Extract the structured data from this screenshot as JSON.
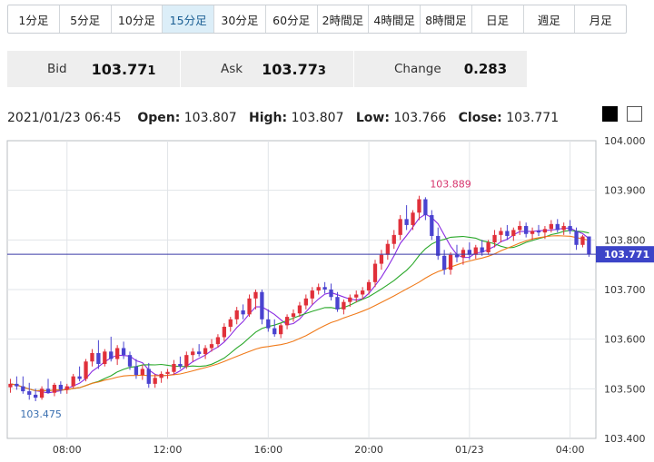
{
  "timeframes": [
    {
      "label": "1分足",
      "active": false
    },
    {
      "label": "5分足",
      "active": false
    },
    {
      "label": "10分足",
      "active": false
    },
    {
      "label": "15分足",
      "active": true
    },
    {
      "label": "30分足",
      "active": false
    },
    {
      "label": "60分足",
      "active": false
    },
    {
      "label": "2時間足",
      "active": false
    },
    {
      "label": "4時間足",
      "active": false
    },
    {
      "label": "8時間足",
      "active": false
    },
    {
      "label": "日足",
      "active": false
    },
    {
      "label": "週足",
      "active": false
    },
    {
      "label": "月足",
      "active": false
    }
  ],
  "quote": {
    "bid_label": "Bid",
    "bid_main": "103.77",
    "bid_last": "1",
    "ask_label": "Ask",
    "ask_main": "103.77",
    "ask_last": "3",
    "change_label": "Change",
    "change_value": "0.283"
  },
  "ohlc": {
    "datetime": "2021/01/23 06:45",
    "open_label": "Open:",
    "open": "103.807",
    "high_label": "High:",
    "high": "103.807",
    "low_label": "Low:",
    "low": "103.766",
    "close_label": "Close:",
    "close": "103.771"
  },
  "theme_swatches": [
    "black",
    "white"
  ],
  "chart_data": {
    "type": "candlestick",
    "instrument_precision": 3,
    "ylim": [
      103.4,
      104.0
    ],
    "y_ticks": [
      "104.000",
      "103.900",
      "103.800",
      "103.700",
      "103.600",
      "103.500",
      "103.400"
    ],
    "x_ticks": [
      {
        "label": "08:00",
        "index": 9
      },
      {
        "label": "12:00",
        "index": 25
      },
      {
        "label": "16:00",
        "index": 41
      },
      {
        "label": "20:00",
        "index": 57
      },
      {
        "label": "01/23",
        "index": 73
      },
      {
        "label": "04:00",
        "index": 89
      }
    ],
    "last_price": {
      "label": "103.771",
      "value": 103.771
    },
    "max_annotation": {
      "label": "103.889",
      "value": 103.889,
      "index": 70
    },
    "min_annotation": {
      "label": "103.475",
      "value": 103.475,
      "index": 4
    },
    "up_color": "#e0303a",
    "down_color": "#4a43d0",
    "ma_colors": [
      "#8a2be2",
      "#2aa82a",
      "#f07a1a"
    ],
    "candles": [
      [
        103.503,
        103.52,
        103.492,
        103.51
      ],
      [
        103.51,
        103.525,
        103.498,
        103.505
      ],
      [
        103.505,
        103.525,
        103.49,
        103.495
      ],
      [
        103.495,
        103.512,
        103.478,
        103.488
      ],
      [
        103.488,
        103.5,
        103.475,
        103.482
      ],
      [
        103.482,
        103.505,
        103.478,
        103.5
      ],
      [
        103.5,
        103.52,
        103.49,
        103.492
      ],
      [
        103.492,
        103.512,
        103.485,
        103.508
      ],
      [
        103.508,
        103.515,
        103.49,
        103.498
      ],
      [
        103.498,
        103.51,
        103.49,
        103.505
      ],
      [
        103.505,
        103.53,
        103.5,
        103.525
      ],
      [
        103.525,
        103.545,
        103.515,
        103.52
      ],
      [
        103.52,
        103.56,
        103.515,
        103.555
      ],
      [
        103.555,
        103.58,
        103.545,
        103.572
      ],
      [
        103.572,
        103.598,
        103.54,
        103.55
      ],
      [
        103.55,
        103.58,
        103.545,
        103.575
      ],
      [
        103.575,
        103.605,
        103.555,
        103.56
      ],
      [
        103.56,
        103.588,
        103.548,
        103.582
      ],
      [
        103.582,
        103.595,
        103.56,
        103.568
      ],
      [
        103.568,
        103.575,
        103.538,
        103.545
      ],
      [
        103.545,
        103.56,
        103.52,
        103.528
      ],
      [
        103.528,
        103.548,
        103.518,
        103.54
      ],
      [
        103.54,
        103.552,
        103.502,
        103.51
      ],
      [
        103.51,
        103.53,
        103.502,
        103.522
      ],
      [
        103.522,
        103.535,
        103.512,
        103.53
      ],
      [
        103.53,
        103.54,
        103.52,
        103.534
      ],
      [
        103.534,
        103.558,
        103.528,
        103.55
      ],
      [
        103.55,
        103.565,
        103.54,
        103.545
      ],
      [
        103.545,
        103.575,
        103.54,
        103.568
      ],
      [
        103.568,
        103.582,
        103.555,
        103.575
      ],
      [
        103.575,
        103.59,
        103.565,
        103.57
      ],
      [
        103.57,
        103.588,
        103.56,
        103.582
      ],
      [
        103.582,
        103.6,
        103.575,
        103.59
      ],
      [
        103.59,
        103.61,
        103.583,
        103.604
      ],
      [
        103.604,
        103.632,
        103.596,
        103.625
      ],
      [
        103.625,
        103.645,
        103.615,
        103.64
      ],
      [
        103.64,
        103.665,
        103.63,
        103.658
      ],
      [
        103.658,
        103.67,
        103.64,
        103.65
      ],
      [
        103.65,
        103.69,
        103.645,
        103.682
      ],
      [
        103.682,
        103.7,
        103.66,
        103.695
      ],
      [
        103.695,
        103.7,
        103.63,
        103.64
      ],
      [
        103.64,
        103.66,
        103.615,
        103.622
      ],
      [
        103.622,
        103.64,
        103.605,
        103.61
      ],
      [
        103.61,
        103.632,
        103.602,
        103.628
      ],
      [
        103.628,
        103.65,
        103.62,
        103.645
      ],
      [
        103.645,
        103.66,
        103.635,
        103.652
      ],
      [
        103.652,
        103.675,
        103.645,
        103.668
      ],
      [
        103.668,
        103.69,
        103.66,
        103.682
      ],
      [
        103.682,
        103.705,
        103.67,
        103.698
      ],
      [
        103.698,
        103.712,
        103.69,
        103.705
      ],
      [
        103.705,
        103.715,
        103.692,
        103.7
      ],
      [
        103.7,
        103.712,
        103.678,
        103.685
      ],
      [
        103.685,
        103.695,
        103.655,
        103.66
      ],
      [
        103.66,
        103.68,
        103.65,
        103.675
      ],
      [
        103.675,
        103.69,
        103.665,
        103.684
      ],
      [
        103.684,
        103.698,
        103.674,
        103.69
      ],
      [
        103.69,
        103.705,
        103.68,
        103.698
      ],
      [
        103.698,
        103.72,
        103.69,
        103.715
      ],
      [
        103.715,
        103.76,
        103.705,
        103.752
      ],
      [
        103.752,
        103.78,
        103.74,
        103.77
      ],
      [
        103.77,
        103.8,
        103.76,
        103.792
      ],
      [
        103.792,
        103.82,
        103.782,
        103.81
      ],
      [
        103.81,
        103.85,
        103.8,
        103.842
      ],
      [
        103.842,
        103.87,
        103.82,
        103.83
      ],
      [
        103.83,
        103.86,
        103.82,
        103.855
      ],
      [
        103.855,
        103.889,
        103.84,
        103.882
      ],
      [
        103.882,
        103.886,
        103.84,
        103.85
      ],
      [
        103.85,
        103.86,
        103.8,
        103.808
      ],
      [
        103.808,
        103.825,
        103.76,
        103.768
      ],
      [
        103.768,
        103.78,
        103.73,
        103.74
      ],
      [
        103.74,
        103.775,
        103.73,
        103.77
      ],
      [
        103.77,
        103.79,
        103.755,
        103.765
      ],
      [
        103.765,
        103.785,
        103.75,
        103.78
      ],
      [
        103.78,
        103.795,
        103.76,
        103.77
      ],
      [
        103.77,
        103.79,
        103.762,
        103.785
      ],
      [
        103.785,
        103.8,
        103.768,
        103.775
      ],
      [
        103.775,
        103.8,
        103.77,
        103.795
      ],
      [
        103.795,
        103.82,
        103.785,
        103.81
      ],
      [
        103.81,
        103.825,
        103.795,
        103.818
      ],
      [
        103.818,
        103.83,
        103.8,
        103.808
      ],
      [
        103.808,
        103.825,
        103.798,
        103.82
      ],
      [
        103.82,
        103.838,
        103.81,
        103.828
      ],
      [
        103.828,
        103.835,
        103.805,
        103.812
      ],
      [
        103.812,
        103.825,
        103.8,
        103.818
      ],
      [
        103.818,
        103.83,
        103.808,
        103.815
      ],
      [
        103.815,
        103.828,
        103.802,
        103.822
      ],
      [
        103.822,
        103.84,
        103.815,
        103.832
      ],
      [
        103.832,
        103.842,
        103.815,
        103.82
      ],
      [
        103.82,
        103.835,
        103.81,
        103.828
      ],
      [
        103.828,
        103.84,
        103.812,
        103.818
      ],
      [
        103.818,
        103.825,
        103.78,
        103.79
      ],
      [
        103.79,
        103.81,
        103.785,
        103.807
      ],
      [
        103.807,
        103.807,
        103.766,
        103.771
      ]
    ]
  }
}
